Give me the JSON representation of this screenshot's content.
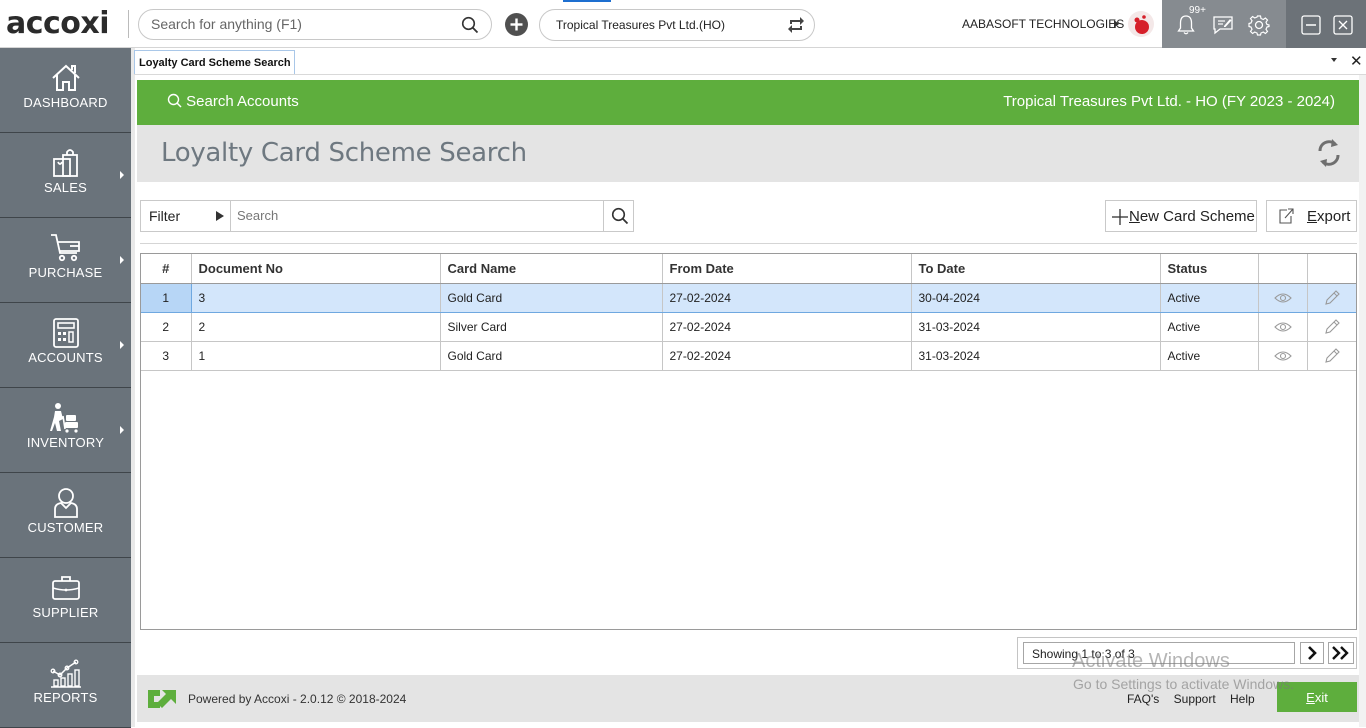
{
  "app": {
    "logo": "accoxi",
    "global_search": {
      "placeholder": "Search for anything (F1)",
      "value": ""
    },
    "company_selector": "Tropical Treasures Pvt Ltd.(HO)",
    "organization": "AABASOFT TECHNOLOGIES",
    "notification_count": "99+"
  },
  "sidebar": {
    "items": [
      {
        "label": "DASHBOARD",
        "icon": "home-icon",
        "has_submenu": false
      },
      {
        "label": "SALES",
        "icon": "shopping-bag-icon",
        "has_submenu": true
      },
      {
        "label": "PURCHASE",
        "icon": "cart-icon",
        "has_submenu": true
      },
      {
        "label": "ACCOUNTS",
        "icon": "calculator-icon",
        "has_submenu": true
      },
      {
        "label": "INVENTORY",
        "icon": "inventory-worker-icon",
        "has_submenu": true
      },
      {
        "label": "CUSTOMER",
        "icon": "customer-icon",
        "has_submenu": false
      },
      {
        "label": "SUPPLIER",
        "icon": "briefcase-icon",
        "has_submenu": false
      },
      {
        "label": "REPORTS",
        "icon": "reports-chart-icon",
        "has_submenu": false
      }
    ]
  },
  "tabs": [
    {
      "label": "Loyalty Card Scheme Search",
      "active": true
    }
  ],
  "header": {
    "search_accounts": "Search Accounts",
    "company_fy": "Tropical Treasures Pvt Ltd. - HO (FY 2023 - 2024)",
    "page_title": "Loyalty Card Scheme Search"
  },
  "toolbar": {
    "filter_label": "Filter",
    "search_placeholder": "Search",
    "search_value": "",
    "new_button_prefix": "N",
    "new_button_rest": "ew Card Scheme",
    "export_prefix": "E",
    "export_rest": "xport"
  },
  "table": {
    "columns": [
      "#",
      "Document No",
      "Card Name",
      "From Date",
      "To Date",
      "Status",
      "",
      ""
    ],
    "rows": [
      {
        "index": "1",
        "document_no": "3",
        "card_name": "Gold Card",
        "from_date": "27-02-2024",
        "to_date": "30-04-2024",
        "status": "Active",
        "selected": true
      },
      {
        "index": "2",
        "document_no": "2",
        "card_name": "Silver Card",
        "from_date": "27-02-2024",
        "to_date": "31-03-2024",
        "status": "Active",
        "selected": false
      },
      {
        "index": "3",
        "document_no": "1",
        "card_name": "Gold Card",
        "from_date": "27-02-2024",
        "to_date": "31-03-2024",
        "status": "Active",
        "selected": false
      }
    ]
  },
  "pager": {
    "text": "Showing 1 to 3 of 3"
  },
  "footer": {
    "powered_by": "Powered by Accoxi - 2.0.12 © 2018-2024",
    "links": [
      "FAQ's",
      "Support",
      "Help"
    ],
    "exit_prefix": "E",
    "exit_rest": "xit"
  },
  "watermark": {
    "line1": "Activate Windows",
    "line2": "Go to Settings to activate Windows."
  },
  "colors": {
    "brand_green": "#5eae3d",
    "sidebar_bg": "#6a737b",
    "selected_row": "#d3e6fb"
  }
}
